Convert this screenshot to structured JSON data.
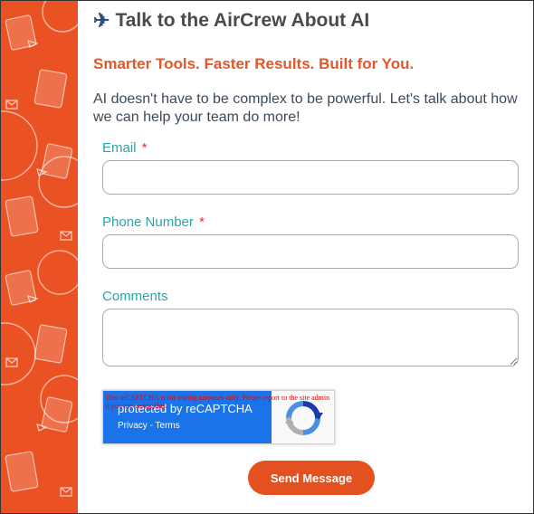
{
  "header": {
    "icon": "airplane-icon",
    "title": "Talk to the AirCrew About AI",
    "subtitle": "Smarter Tools. Faster Results. Built for You.",
    "description": "AI doesn't have to be complex to be powerful. Let's talk about how we can help your team do more!"
  },
  "form": {
    "email": {
      "label": "Email",
      "required_mark": "*",
      "value": ""
    },
    "phone": {
      "label": "Phone Number",
      "required_mark": "*",
      "value": ""
    },
    "comments": {
      "label": "Comments",
      "value": ""
    },
    "recaptcha": {
      "warning": "This reCAPTCHA is for testing purposes only. Please report to the site admin if you are seeing this.",
      "protected_by": "protected by reCAPTCHA",
      "privacy": "Privacy",
      "separator": " - ",
      "terms": "Terms"
    },
    "submit_label": "Send Message"
  },
  "colors": {
    "sidebar": "#ea5223",
    "accent": "#e2572b",
    "label": "#2aa5a8",
    "required": "#dd3333"
  }
}
